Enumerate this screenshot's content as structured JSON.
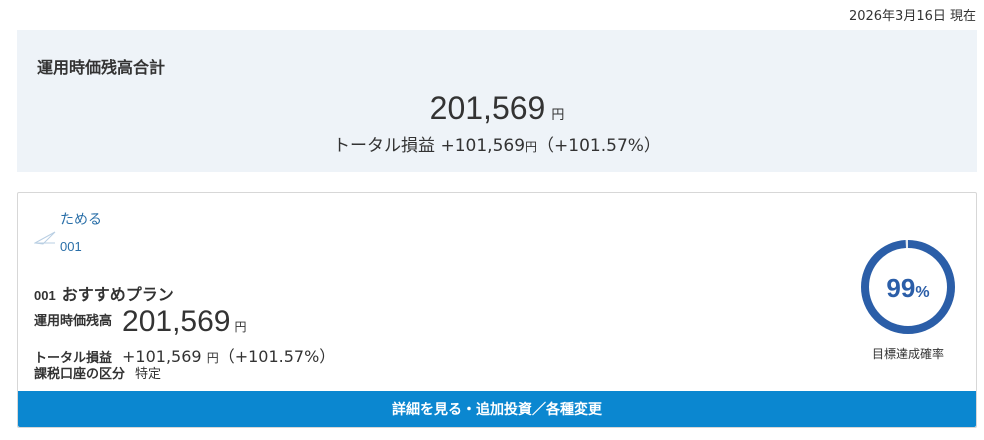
{
  "header": {
    "date": "2026年3月16日 現在"
  },
  "summary": {
    "title": "運用時価残高合計",
    "amount": "201,569",
    "unit": "円",
    "pl_label": "トータル損益",
    "pl_value": "+101,569",
    "pl_unit": "円",
    "pl_percent": "（+101.57%）"
  },
  "plan": {
    "category": "ためる",
    "goal_icon": "paper-plane-icon",
    "goal_number": "001",
    "code": "001",
    "name": "おすすめプラン",
    "balance_label": "運用時価残高",
    "balance_value": "201,569",
    "balance_unit": "円",
    "pl_label": "トータル損益",
    "pl_value": "+101,569",
    "pl_unit": "円",
    "pl_percent": "（+101.57%）",
    "tax_label": "課税口座の区分",
    "tax_value": "特定",
    "achievement": {
      "value": "99",
      "unit": "%",
      "fraction": 0.99,
      "caption": "目標達成確率",
      "color": "#2b5ea8"
    },
    "detail_button": "詳細を見る・追加投資／各種変更"
  }
}
